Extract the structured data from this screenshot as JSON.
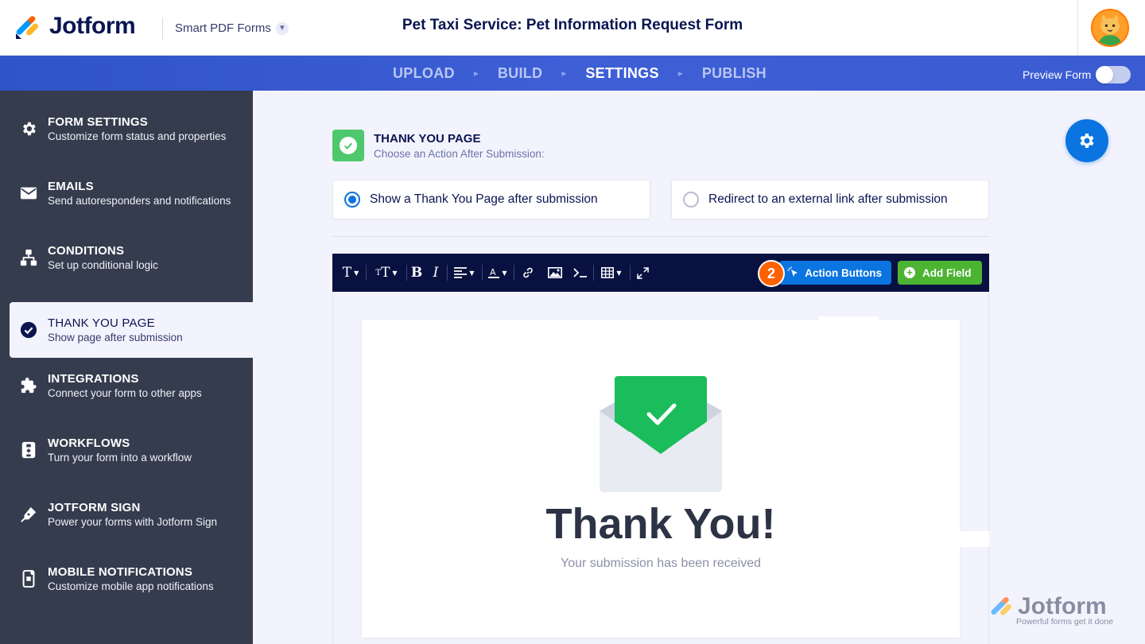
{
  "header": {
    "logo_text": "Jotform",
    "product_label": "Smart PDF Forms",
    "form_title": "Pet Taxi Service: Pet Information Request Form"
  },
  "steps": [
    {
      "label": "UPLOAD",
      "active": false
    },
    {
      "label": "BUILD",
      "active": false
    },
    {
      "label": "SETTINGS",
      "active": true
    },
    {
      "label": "PUBLISH",
      "active": false
    }
  ],
  "preview": {
    "label": "Preview Form",
    "enabled": false
  },
  "sidebar": {
    "items": [
      {
        "title": "FORM SETTINGS",
        "subtitle": "Customize form status and properties",
        "icon": "gear-icon"
      },
      {
        "title": "EMAILS",
        "subtitle": "Send autoresponders and notifications",
        "icon": "envelope-icon"
      },
      {
        "title": "CONDITIONS",
        "subtitle": "Set up conditional logic",
        "icon": "conditions-icon"
      },
      {
        "title": "THANK YOU PAGE",
        "subtitle": "Show page after submission",
        "icon": "check-circle-icon",
        "active": true
      },
      {
        "title": "INTEGRATIONS",
        "subtitle": "Connect your form to other apps",
        "icon": "puzzle-icon"
      },
      {
        "title": "WORKFLOWS",
        "subtitle": "Turn your form into a workflow",
        "icon": "workflow-icon"
      },
      {
        "title": "JOTFORM SIGN",
        "subtitle": "Power your forms with Jotform Sign",
        "icon": "pen-icon"
      },
      {
        "title": "MOBILE NOTIFICATIONS",
        "subtitle": "Customize mobile app notifications",
        "icon": "mobile-icon"
      }
    ]
  },
  "thank_you": {
    "title": "THANK YOU PAGE",
    "subtitle": "Choose an Action After Submission:",
    "options": [
      {
        "label": "Show a Thank You Page after submission",
        "selected": true
      },
      {
        "label": "Redirect to an external link after submission",
        "selected": false
      }
    ]
  },
  "toolbar": {
    "action_buttons_label": "Action Buttons",
    "add_field_label": "Add Field",
    "step_badge": "2"
  },
  "preview_card": {
    "heading": "Thank You!",
    "message": "Your submission has been received"
  },
  "watermark": {
    "brand": "Jotform",
    "tagline": "Powerful forms get it done"
  },
  "colors": {
    "primary_blue": "#0a74e0",
    "navy": "#0a1551",
    "sidebar_bg": "#343c4e",
    "success_green": "#1bbc5b",
    "add_field_green": "#4db433",
    "badge_orange": "#ff6100"
  }
}
